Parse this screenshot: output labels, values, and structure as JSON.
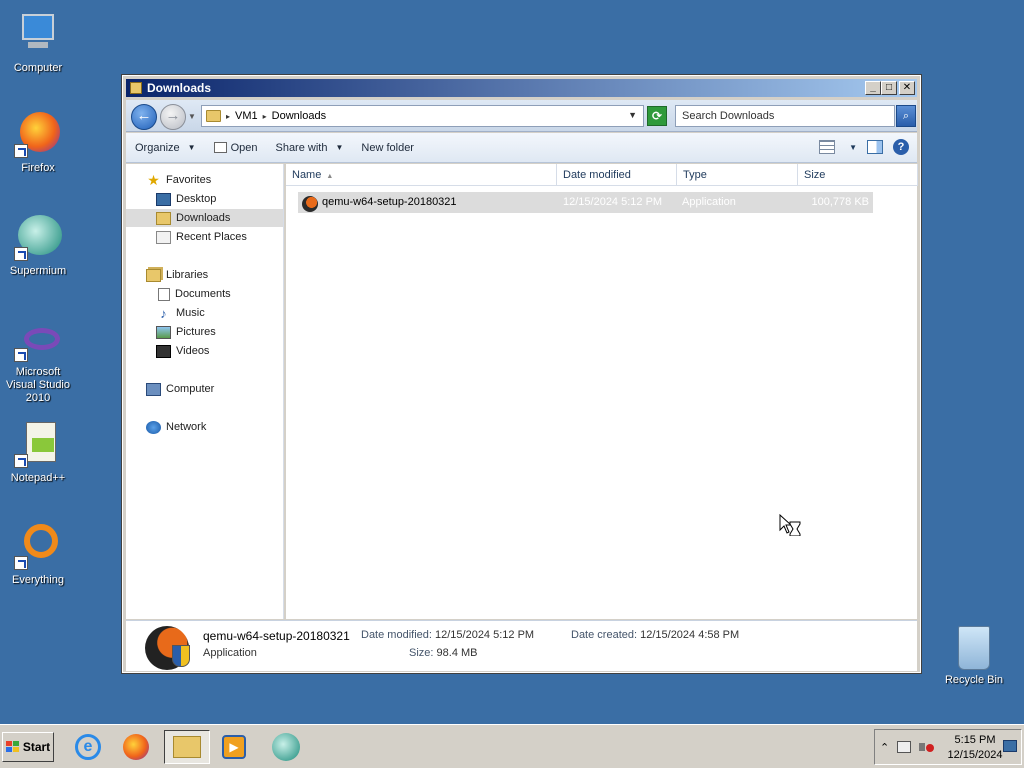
{
  "desktop": {
    "icons": [
      {
        "label": "Computer"
      },
      {
        "label": "Firefox"
      },
      {
        "label": "Supermium"
      },
      {
        "label": "Microsoft Visual Studio 2010"
      },
      {
        "label": "Notepad++"
      },
      {
        "label": "Everything"
      }
    ],
    "recycle_bin": "Recycle Bin"
  },
  "window": {
    "title": "Downloads",
    "address": {
      "segment1": "VM1",
      "segment2": "Downloads"
    },
    "search_placeholder": "Search Downloads",
    "commands": {
      "organize": "Organize",
      "open": "Open",
      "share": "Share with",
      "new_folder": "New folder"
    },
    "nav": {
      "favorites": "Favorites",
      "desktop": "Desktop",
      "downloads": "Downloads",
      "recent": "Recent Places",
      "libraries": "Libraries",
      "documents": "Documents",
      "music": "Music",
      "pictures": "Pictures",
      "videos": "Videos",
      "computer": "Computer",
      "network": "Network"
    },
    "columns": {
      "name": "Name",
      "date": "Date modified",
      "type": "Type",
      "size": "Size"
    },
    "files": [
      {
        "name": "qemu-w64-setup-20180321",
        "date": "12/15/2024 5:12 PM",
        "type": "Application",
        "size": "100,778 KB"
      }
    ],
    "details": {
      "name": "qemu-w64-setup-20180321",
      "type": "Application",
      "modified_label": "Date modified:",
      "modified_value": "12/15/2024 5:12 PM",
      "size_label": "Size:",
      "size_value": "98.4 MB",
      "created_label": "Date created:",
      "created_value": "12/15/2024 4:58 PM"
    }
  },
  "taskbar": {
    "start": "Start",
    "clock_time": "5:15 PM",
    "clock_date": "12/15/2024"
  }
}
